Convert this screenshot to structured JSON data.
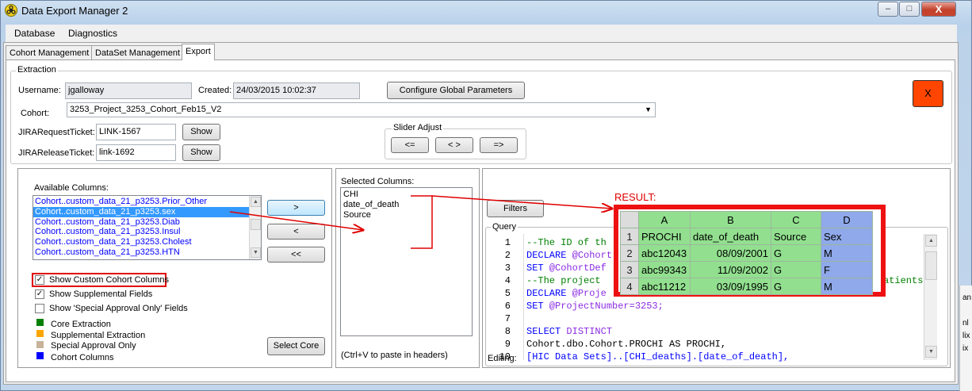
{
  "window": {
    "title": "Data Export Manager 2",
    "buttons": {
      "minimize": "–",
      "maximize": "□",
      "close": "X"
    }
  },
  "menu": [
    "Database",
    "Diagnostics"
  ],
  "tabs": [
    "Cohort Management",
    "DataSet Management",
    "Export"
  ],
  "extraction": {
    "group_label": "Extraction",
    "username_label": "Username:",
    "username_value": "jgalloway",
    "created_label": "Created:",
    "created_value": "24/03/2015 10:02:37",
    "configure_button": "Configure Global Parameters",
    "cohort_label": "Cohort:",
    "cohort_value": "3253_Project_3253_Cohort_Feb15_V2",
    "jira_request_label": "JIRARequestTicket:",
    "jira_request_value": "LINK-1567",
    "jira_release_label": "JIRAReleaseTicket:",
    "jira_release_value": "link-1692",
    "show_button": "Show",
    "slider_label": "Slider Adjust",
    "slider_buttons": [
      "<=",
      "< >",
      "=>"
    ],
    "x_button": "X"
  },
  "available": {
    "label": "Available Columns:",
    "items": [
      "Cohort..custom_data_21_p3253.Prior_Other",
      "Cohort..custom_data_21_p3253.sex",
      "Cohort..custom_data_21_p3253.Diab",
      "Cohort..custom_data_21_p3253.Insul",
      "Cohort..custom_data_21_p3253.Cholest",
      "Cohort..custom_data_21_p3253.HTN"
    ],
    "selected_index": 1,
    "move_buttons": [
      ">",
      "<",
      "<<"
    ],
    "checkboxes": [
      {
        "label": "Show Custom Cohort Columns",
        "checked": true
      },
      {
        "label": "Show Supplemental Fields",
        "checked": true
      },
      {
        "label": "Show 'Special Approval Only' Fields",
        "checked": false
      }
    ],
    "legend": [
      {
        "label": "Core Extraction",
        "color": "#008000"
      },
      {
        "label": "Supplemental Extraction",
        "color": "#ffa500"
      },
      {
        "label": "Special Approval Only",
        "color": "#c8b39a"
      },
      {
        "label": "Cohort Columns",
        "color": "#0000ff"
      }
    ],
    "select_core_button": "Select Core"
  },
  "selected": {
    "label": "Selected Columns:",
    "items": [
      "CHI",
      "date_of_death",
      "Source"
    ],
    "hint": "(Ctrl+V to paste in headers)"
  },
  "query": {
    "filters_button": "Filters",
    "label": "Query",
    "status_label": "Editing:",
    "lines": [
      {
        "num": "1",
        "text": "--The ID of th",
        "kind": "comment"
      },
      {
        "num": "2",
        "text": "DECLARE @Cohort",
        "kind": "keyword"
      },
      {
        "num": "3",
        "text": "SET @CohortDef",
        "kind": "keyword"
      },
      {
        "num": "4",
        "text": "--The project",
        "kind": "comment",
        "tail": "atients"
      },
      {
        "num": "5",
        "text": "DECLARE @Proje",
        "kind": "keyword"
      },
      {
        "num": "6",
        "text": "SET @ProjectNumber=3253;",
        "kind": "keyword"
      },
      {
        "num": "7",
        "text": "",
        "kind": "plain"
      },
      {
        "num": "8",
        "text": "SELECT DISTINCT",
        "kind": "keyword"
      },
      {
        "num": "9",
        "text": "Cohort.dbo.Cohort.PROCHI AS PROCHI,",
        "kind": "plain"
      },
      {
        "num": "10",
        "text": "[HIC Data Sets]..[CHI_deaths].[date_of_death],",
        "kind": "ident"
      }
    ]
  },
  "result": {
    "label": "RESULT:",
    "columns": [
      "A",
      "B",
      "C",
      "D"
    ],
    "rows": [
      {
        "n": "1",
        "cells": [
          "PROCHI",
          "date_of_death",
          "Source",
          "Sex"
        ]
      },
      {
        "n": "2",
        "cells": [
          "abc12043",
          "08/09/2001",
          "G",
          "M"
        ]
      },
      {
        "n": "3",
        "cells": [
          "abc99343",
          "11/09/2002",
          "G",
          "F"
        ]
      },
      {
        "n": "4",
        "cells": [
          "abc11212",
          "03/09/1995",
          "G",
          "M"
        ]
      }
    ]
  },
  "background_fragments": [
    "an",
    "nl",
    "lix",
    "ix"
  ]
}
